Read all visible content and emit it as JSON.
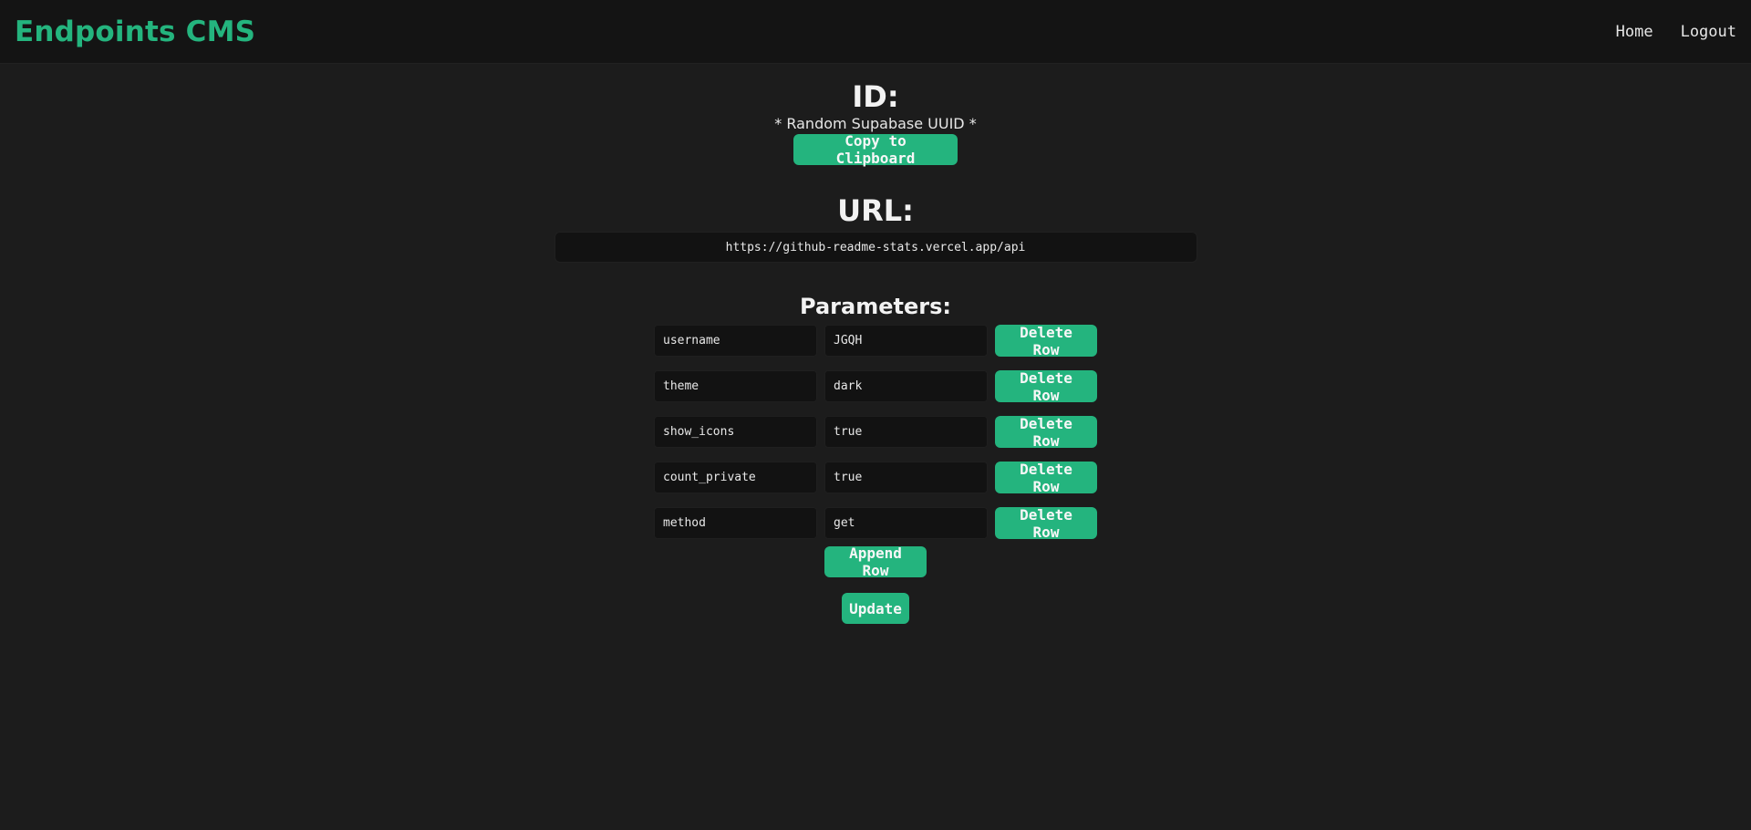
{
  "navbar": {
    "brand": "Endpoints CMS",
    "links": [
      "Home",
      "Logout"
    ]
  },
  "id_section": {
    "heading": "ID:",
    "note": "* Random Supabase UUID *",
    "copy_button": "Copy to Clipboard"
  },
  "url_section": {
    "heading": "URL:",
    "value": "https://github-readme-stats.vercel.app/api"
  },
  "params_section": {
    "heading": "Parameters:",
    "rows": [
      {
        "key": "username",
        "value": "JGQH",
        "delete_label": "Delete Row"
      },
      {
        "key": "theme",
        "value": "dark",
        "delete_label": "Delete Row"
      },
      {
        "key": "show_icons",
        "value": "true",
        "delete_label": "Delete Row"
      },
      {
        "key": "count_private",
        "value": "true",
        "delete_label": "Delete Row"
      },
      {
        "key": "method",
        "value": "get",
        "delete_label": "Delete Row"
      }
    ],
    "append_button": "Append Row",
    "update_button": "Update"
  },
  "colors": {
    "accent": "#24b47e",
    "background": "#1c1c1c",
    "navbar": "#141414",
    "input": "#121212"
  }
}
